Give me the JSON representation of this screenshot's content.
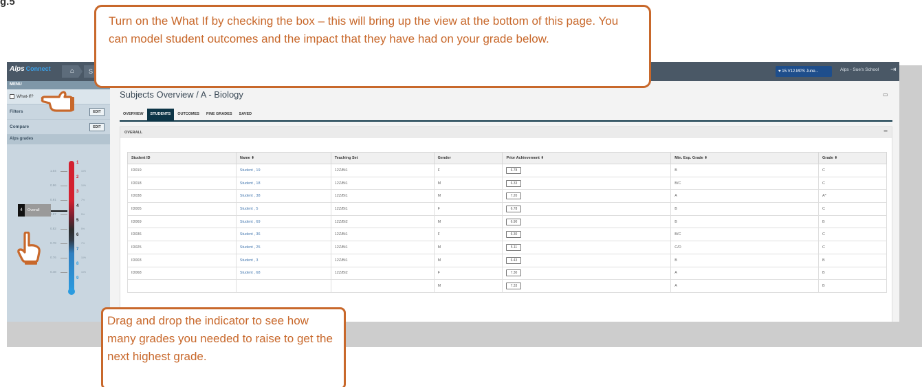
{
  "page_label": "g.5",
  "app": {
    "logo_alps": "Alps",
    "logo_connect": "Connect",
    "home_crumb": "⌂",
    "crumb_2": "S",
    "term_label": "15.V12.MPS June...",
    "school_name": "Alps - Sue's School"
  },
  "sidebar": {
    "menu_label": "MENU",
    "what_if_label": "What-If?",
    "filters_label": "Filters",
    "compare_label": "Compare",
    "edit_label": "EDIT",
    "alps_grades_label": "Alps grades",
    "thermometer": {
      "grades": [
        "1",
        "2",
        "3",
        "4",
        "5",
        "6",
        "7",
        "8",
        "9"
      ],
      "scale_labels": [
        "1.04",
        "0.96",
        "0.91",
        "0.87",
        "0.82",
        "0.78",
        "0.76",
        "0.48"
      ],
      "pct_labels": [
        "10%",
        "10%",
        "7%",
        "5%",
        "5%",
        "7%",
        "10%",
        "10%"
      ],
      "overall_value": "4",
      "overall_label": "Overall"
    }
  },
  "main": {
    "title": "Subjects Overview / A - Biology",
    "tabs": [
      {
        "label": "OVERVIEW",
        "active": false
      },
      {
        "label": "STUDENTS",
        "active": true
      },
      {
        "label": "OUTCOMES",
        "active": false
      },
      {
        "label": "FINE GRADES",
        "active": false
      },
      {
        "label": "SAVED",
        "active": false
      }
    ],
    "section_label": "OVERALL",
    "collapse_symbol": "−",
    "table": {
      "columns": [
        "Student ID",
        "Name ⬍",
        "Teaching Set",
        "Gender",
        "Prior Achievement ⬍",
        "Min. Exp. Grade ⬍",
        "Grade ⬍"
      ],
      "rows": [
        [
          "ID019",
          "Student , 19",
          "12Z/Bi1",
          "F",
          "6.78",
          "B",
          "C"
        ],
        [
          "ID018",
          "Student , 18",
          "12Z/Bi1",
          "M",
          "6.33",
          "B/C",
          "C"
        ],
        [
          "ID038",
          "Student , 38",
          "12Z/Bi1",
          "M",
          "7.20",
          "A",
          "A*"
        ],
        [
          "ID005",
          "Student , 5",
          "12Z/Bi1",
          "F",
          "6.78",
          "B",
          "C"
        ],
        [
          "ID069",
          "Student , 69",
          "12Z/Bi2",
          "M",
          "6.90",
          "B",
          "B"
        ],
        [
          "ID036",
          "Student , 36",
          "12Z/Bi1",
          "F",
          "6.30",
          "B/C",
          "C"
        ],
        [
          "ID025",
          "Student , 25",
          "12Z/Bi1",
          "M",
          "5.11",
          "C/D",
          "C"
        ],
        [
          "ID003",
          "Student , 3",
          "12Z/Bi1",
          "M",
          "6.43",
          "B",
          "B"
        ],
        [
          "ID068",
          "Student , 68",
          "12Z/Bi2",
          "F",
          "7.30",
          "A",
          "B"
        ],
        [
          "",
          "",
          "",
          "M",
          "7.33",
          "A",
          "B"
        ]
      ]
    }
  },
  "callouts": {
    "top": "Turn on the What If by checking the box – this will bring up the view at the bottom of this page. You can model student outcomes and the impact that they have had on your grade below.",
    "bottom": "Drag and drop the indicator to see how many grades you needed to raise to get the next highest grade."
  },
  "colors": {
    "accent": "#c8682b",
    "topbar": "#4a5866",
    "tab_active": "#0d3547"
  }
}
